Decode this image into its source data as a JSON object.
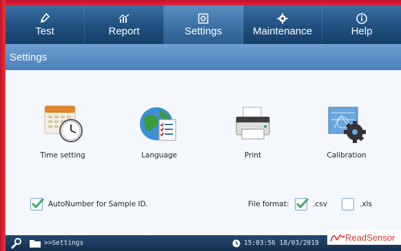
{
  "nav": {
    "items": [
      {
        "label": "Test",
        "icon": "flask-icon"
      },
      {
        "label": "Report",
        "icon": "chart-icon"
      },
      {
        "label": "Settings",
        "icon": "settings-icon",
        "active": true
      },
      {
        "label": "Maintenance",
        "icon": "gear-icon"
      },
      {
        "label": "Help",
        "icon": "info-icon"
      }
    ]
  },
  "page": {
    "title": "Settings"
  },
  "tiles": [
    {
      "label": "Time setting",
      "icon": "calendar-clock-icon"
    },
    {
      "label": "Language",
      "icon": "globe-document-icon"
    },
    {
      "label": "Print",
      "icon": "printer-icon"
    },
    {
      "label": "Calibration",
      "icon": "blueprint-gear-icon"
    }
  ],
  "options": {
    "autonumber": {
      "label": "AutoNumber for Sample ID.",
      "checked": true
    },
    "file_format_label": "File format:",
    "csv": {
      "label": ".csv",
      "checked": true
    },
    "xls": {
      "label": ".xls",
      "checked": false
    }
  },
  "status": {
    "breadcrumb": ">>Settings",
    "datetime": "15:03:56 18/03/2019",
    "brand": "ReadSensor"
  },
  "colors": {
    "nav_dark": "#163f68",
    "nav_light": "#3a6fa3",
    "title_bar": "#5a8ac3",
    "check": "#3ba66a",
    "brand": "#d33a32"
  }
}
